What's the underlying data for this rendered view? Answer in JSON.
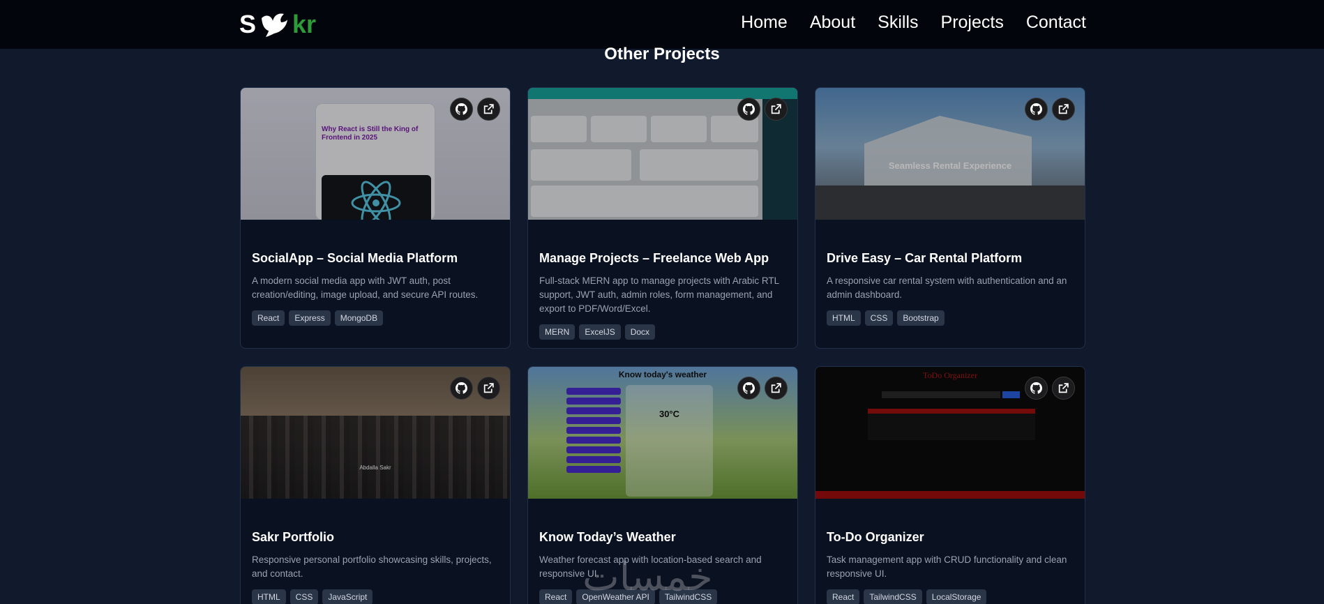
{
  "header": {
    "logo_left": "S",
    "logo_right": "kr",
    "nav": [
      "Home",
      "About",
      "Skills",
      "Projects",
      "Contact"
    ]
  },
  "section_title": "Other Projects",
  "projects": [
    {
      "title": "SocialApp – Social Media Platform",
      "description": "A modern social media app with JWT auth, post creation/editing, image upload, and secure API routes.",
      "tags": [
        "React",
        "Express",
        "MongoDB"
      ],
      "thumb_text": "Why React is Still the King of Frontend in 2025"
    },
    {
      "title": "Manage Projects – Freelance Web App",
      "description": "Full-stack MERN app to manage projects with Arabic RTL support, JWT auth, admin roles, form management, and export to PDF/Word/Excel.",
      "tags": [
        "MERN",
        "ExcelJS",
        "Docx"
      ]
    },
    {
      "title": "Drive Easy – Car Rental Platform",
      "description": "A responsive car rental system with authentication and an admin dashboard.",
      "tags": [
        "HTML",
        "CSS",
        "Bootstrap"
      ],
      "thumb_text": "Seamless Rental Experience"
    },
    {
      "title": "Sakr Portfolio",
      "description": "Responsive personal portfolio showcasing skills, projects, and contact.",
      "tags": [
        "HTML",
        "CSS",
        "JavaScript"
      ],
      "thumb_text": "Abdalla Sakr"
    },
    {
      "title": "Know Today’s Weather",
      "description": "Weather forecast app with location-based search and responsive UI.",
      "tags": [
        "React",
        "OpenWeather API",
        "TailwindCSS"
      ],
      "thumb_title": "Know today's weather",
      "thumb_text": "30°C"
    },
    {
      "title": "To-Do Organizer",
      "description": "Task management app with CRUD functionality and clean responsive UI.",
      "tags": [
        "React",
        "TailwindCSS",
        "LocalStorage"
      ],
      "thumb_text": "ToDo Organizer"
    }
  ],
  "watermark": "خمسات",
  "colors": {
    "background": "#111a2c",
    "navbar": "#02050b",
    "logo_accent": "#2e9b3a",
    "tag_bg": "#2a3548"
  }
}
